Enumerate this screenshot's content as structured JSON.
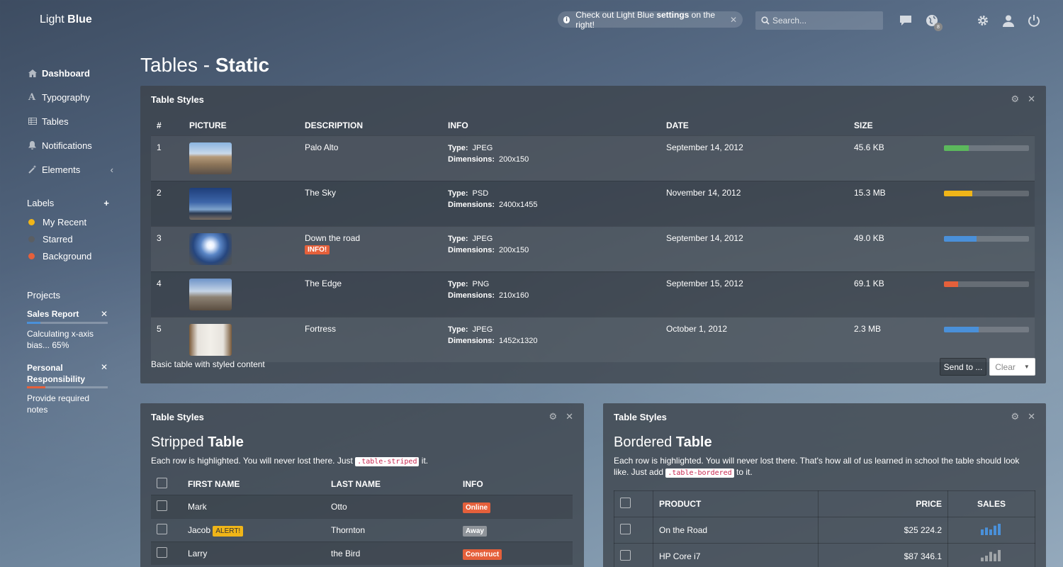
{
  "header": {
    "logo_light": "Light",
    "logo_bold": "Blue",
    "notice_pre": "Check out Light Blue ",
    "notice_bold": "settings",
    "notice_post": " on the right!",
    "search_placeholder": "Search...",
    "globe_badge": "8"
  },
  "sidebar": {
    "nav": [
      {
        "label": "Dashboard",
        "icon": "home-icon"
      },
      {
        "label": "Typography",
        "icon": "font-icon"
      },
      {
        "label": "Tables",
        "icon": "table-icon"
      },
      {
        "label": "Notifications",
        "icon": "bell-icon"
      },
      {
        "label": "Elements",
        "icon": "magic-wand-icon"
      }
    ],
    "labels_title": "Labels",
    "labels_add": "+",
    "labels": [
      {
        "label": "My Recent",
        "color": "#f0b518"
      },
      {
        "label": "Starred",
        "color": "#5a5e63"
      },
      {
        "label": "Background",
        "color": "#e5603b"
      }
    ],
    "projects_title": "Projects",
    "projects": [
      {
        "title": "Sales Report",
        "desc": "Calculating x-axis bias... 65%",
        "progress": 0.17,
        "color": "#4a90d9"
      },
      {
        "title": "Personal Responsibility",
        "desc": "Provide required notes",
        "progress": 0.23,
        "color": "#e5603b"
      }
    ]
  },
  "page": {
    "title_light": "Tables - ",
    "title_bold": "Static"
  },
  "table_styles": {
    "panel_title": "Table Styles",
    "columns": [
      "#",
      "PICTURE",
      "DESCRIPTION",
      "INFO",
      "DATE",
      "SIZE"
    ],
    "type_label": "Type:",
    "dims_label": "Dimensions:",
    "rows": [
      {
        "num": "1",
        "desc": "Palo Alto",
        "tag": "",
        "type": "JPEG",
        "dims": "200x150",
        "date": "September 14, 2012",
        "size": "45.6 KB",
        "progress": 0.29,
        "color": "#5cb85c"
      },
      {
        "num": "2",
        "desc": "The Sky",
        "tag": "",
        "type": "PSD",
        "dims": "2400x1455",
        "date": "November 14, 2012",
        "size": "15.3 MB",
        "progress": 0.33,
        "color": "#f0b518"
      },
      {
        "num": "3",
        "desc": "Down the road",
        "tag": "INFO!",
        "type": "JPEG",
        "dims": "200x150",
        "date": "September 14, 2012",
        "size": "49.0 KB",
        "progress": 0.38,
        "color": "#4a90d9"
      },
      {
        "num": "4",
        "desc": "The Edge",
        "tag": "",
        "type": "PNG",
        "dims": "210x160",
        "date": "September 15, 2012",
        "size": "69.1 KB",
        "progress": 0.17,
        "color": "#e5603b"
      },
      {
        "num": "5",
        "desc": "Fortress",
        "tag": "",
        "type": "JPEG",
        "dims": "1452x1320",
        "date": "October 1, 2012",
        "size": "2.3 MB",
        "progress": 0.41,
        "color": "#4a90d9"
      }
    ],
    "footer_note": "Basic table with styled content",
    "send_label": "Send to ...",
    "clear_label": "Clear"
  },
  "striped": {
    "panel_title": "Table Styles",
    "title_light": "Stripped ",
    "title_bold": "Table",
    "desc_pre": "Each row is highlighted. You will never lost there. Just ",
    "desc_code": ".table-striped",
    "desc_post": " it.",
    "columns": [
      "FIRST NAME",
      "LAST NAME",
      "INFO"
    ],
    "rows": [
      {
        "first": "Mark",
        "alert": "",
        "last": "Otto",
        "status": "Online",
        "status_color": "#e5603b"
      },
      {
        "first": "Jacob",
        "alert": "ALERT!",
        "last": "Thornton",
        "status": "Away",
        "status_color": "#8f949a"
      },
      {
        "first": "Larry",
        "alert": "",
        "last": "the Bird",
        "status": "Construct",
        "status_color": "#e5603b"
      }
    ]
  },
  "bordered": {
    "panel_title": "Table Styles",
    "title_light": "Bordered ",
    "title_bold": "Table",
    "desc_pre": "Each row is highlighted. You will never lost there. That's how all of us learned in school the table should look like. Just add ",
    "desc_code": ".table-bordered",
    "desc_post": " to it.",
    "columns": [
      "PRODUCT",
      "PRICE",
      "SALES"
    ],
    "rows": [
      {
        "product": "On the Road",
        "price": "$25 224.2",
        "sales": [
          3,
          4,
          3,
          5,
          6
        ],
        "color": "#4a90d9"
      },
      {
        "product": "HP Core i7",
        "price": "$87 346.1",
        "sales": [
          2,
          3,
          5,
          4,
          6
        ],
        "color": "#a0a4a8"
      }
    ]
  }
}
